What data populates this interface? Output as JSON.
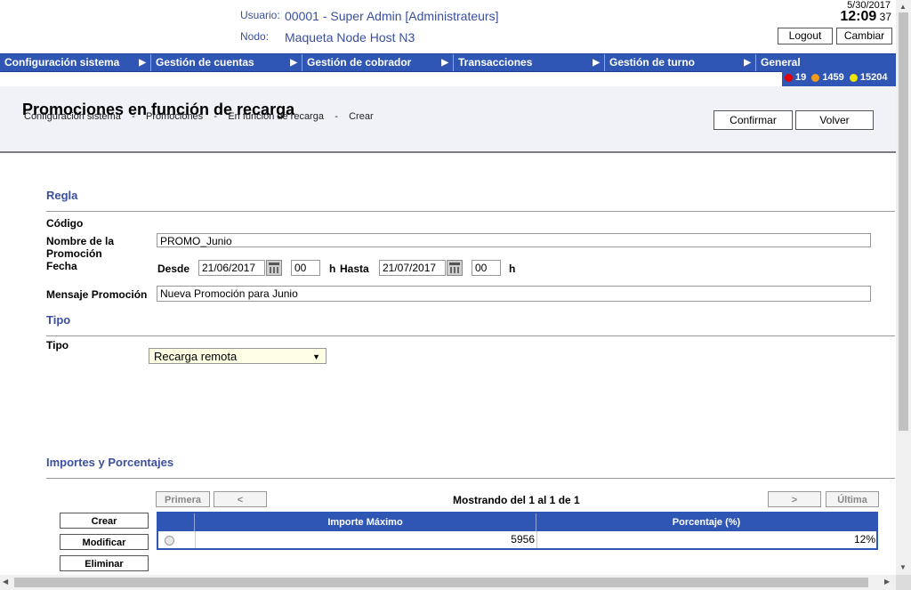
{
  "header": {
    "user_label": "Usuario:",
    "user_value": "00001 - Super Admin [Administrateurs]",
    "node_label": "Nodo:",
    "node_value": "Maqueta Node Host N3",
    "date": "5/30/2017",
    "time": "12:09",
    "seconds": "37",
    "logout": "Logout",
    "change": "Cambiar"
  },
  "menu": [
    {
      "label": "Configuración sistema",
      "arrow": "▶"
    },
    {
      "label": "Gestión de cuentas",
      "arrow": "▶"
    },
    {
      "label": "Gestión de cobrador",
      "arrow": "▶"
    },
    {
      "label": "Transacciones",
      "arrow": "▶"
    },
    {
      "label": "Gestión de turno",
      "arrow": "▶"
    },
    {
      "label": "General",
      "arrow": ""
    }
  ],
  "status": {
    "red_count": "19",
    "orange_count": "1459",
    "yellow_count": "15204",
    "red_color": "#e00000",
    "orange_color": "#f39a1b",
    "yellow_color": "#f2e600"
  },
  "page": {
    "title": "Promociones en función de recarga",
    "breadcrumb": [
      "Configuración sistema",
      "-",
      "Promociones",
      "-",
      "En función de recarga",
      "-",
      "Crear"
    ],
    "confirm": "Confirmar",
    "back": "Volver"
  },
  "rule": {
    "section_title": "Regla",
    "code_label": "Código",
    "name_label": "Nombre de la Promoción",
    "name_value": "PROMO_Junio",
    "date_label": "Fecha",
    "from_label": "Desde",
    "from_date": "21/06/2017",
    "from_hour": "00",
    "hour_unit": "h",
    "to_label": "Hasta",
    "to_date": "21/07/2017",
    "to_hour": "00",
    "message_label": "Mensaje Promoción",
    "message_value": "Nueva Promoción para Junio"
  },
  "type": {
    "section_title": "Tipo",
    "type_label": "Tipo",
    "selected": "Recarga remota"
  },
  "amounts": {
    "section_title": "Importes y Porcentajes",
    "first": "Primera",
    "prev": "<",
    "showing": "Mostrando del 1 al 1 de 1",
    "next": ">",
    "last": "Última",
    "create": "Crear",
    "modify": "Modificar",
    "delete": "Eliminar",
    "columns": [
      "Importe Máximo",
      "Porcentaje (%)"
    ],
    "rows": [
      {
        "max_amount": "5956",
        "percentage": "12%"
      }
    ]
  }
}
